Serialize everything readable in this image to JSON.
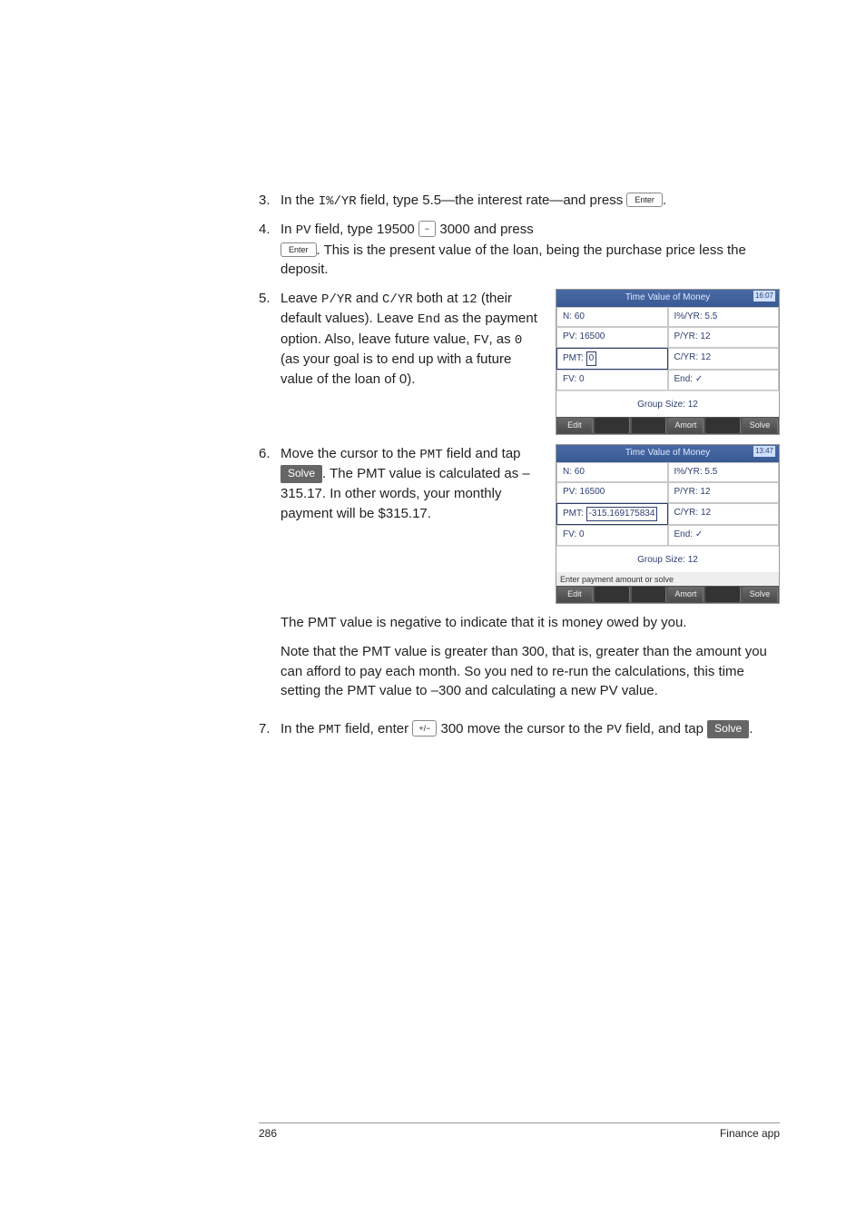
{
  "steps": {
    "s3": {
      "num": "3.",
      "part1": "In the ",
      "field": "I%/YR",
      "part2": " field, type 5.5—the interest rate—and press ",
      "key": "Enter",
      "part3": "."
    },
    "s4": {
      "num": "4.",
      "part1": "In ",
      "field": "PV",
      "part2": " field, type 19500 ",
      "key1_sym": "−",
      "part3": " 3000 and press ",
      "key2": "Enter",
      "part4": ". This is the present value of the loan, being the purchase price less the deposit."
    },
    "s5": {
      "num": "5.",
      "part1": "Leave ",
      "f1": "P/YR",
      "part2": " and ",
      "f2": "C/YR",
      "part3": " both at ",
      "v12": "12",
      "part4": " (their default values). Leave ",
      "f3": "End",
      "part5": " as the payment option. Also, leave future value, ",
      "f4": "FV",
      "part6": ", as ",
      "v0": "0",
      "part7": " (as your goal is to end up with a future value of the loan of 0)."
    },
    "s6": {
      "num": "6.",
      "part1": "Move the cursor to the ",
      "f1": "PMT",
      "part2": " field and tap ",
      "btn": "Solve",
      "part3": ". The PMT value is calculated as –315.17. In other words, your monthly payment will be $315.17.",
      "para2": "The PMT value is negative to indicate that it is money owed by you.",
      "para3": "Note that the PMT value is greater than 300, that is, greater than the amount you can afford to pay each month. So you ned to re-run the calculations, this time setting the PMT value to –300 and calculating a new PV value."
    },
    "s7": {
      "num": "7.",
      "part1": "In the ",
      "f1": "PMT",
      "part2": " field, enter ",
      "key_sym": "+/−",
      "part3": " 300 move the cursor to the ",
      "f2": "PV",
      "part4": " field, and tap ",
      "btn": "Solve",
      "part5": "."
    }
  },
  "screen1": {
    "title": "Time Value of Money",
    "clock": "16:07",
    "n": "N: 60",
    "iyr": "I%/YR: 5.5",
    "pv": "PV: 16500",
    "pyr": "P/YR: 12",
    "pmt_label": "PMT:",
    "pmt_value": "0",
    "cyr": "C/YR: 12",
    "fv": "FV: 0",
    "end": "End: ✓",
    "gs": "Group Size: 12",
    "menu": {
      "edit": "Edit",
      "amort": "Amort",
      "solve": "Solve"
    }
  },
  "screen2": {
    "title": "Time Value of Money",
    "clock": "13:47",
    "n": "N: 60",
    "iyr": "I%/YR: 5.5",
    "pv": "PV: 16500",
    "pyr": "P/YR: 12",
    "pmt_label": "PMT:",
    "pmt_value": "-315.169175834",
    "cyr": "C/YR: 12",
    "fv": "FV: 0",
    "end": "End: ✓",
    "gs": "Group Size: 12",
    "hint": "Enter payment amount or solve",
    "menu": {
      "edit": "Edit",
      "amort": "Amort",
      "solve": "Solve"
    }
  },
  "footer": {
    "page": "286",
    "section": "Finance app"
  }
}
